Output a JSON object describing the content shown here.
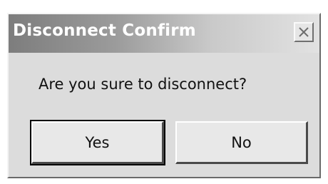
{
  "dialog": {
    "title": "Disconnect Confirm",
    "message": "Are you sure to disconnect?",
    "close_icon": "close-icon",
    "buttons": {
      "yes_label": "Yes",
      "no_label": "No"
    }
  }
}
